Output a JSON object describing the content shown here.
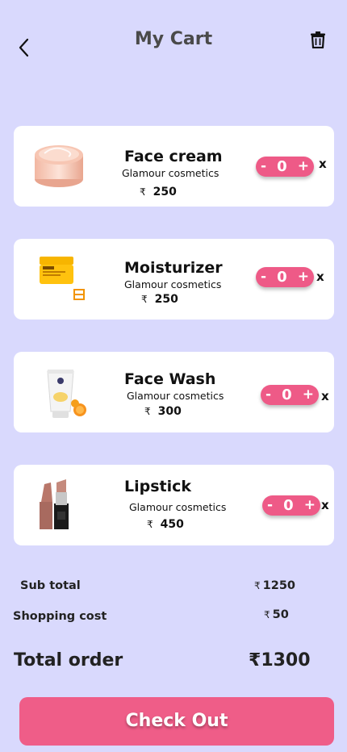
{
  "header": {
    "title": "My Cart",
    "back_icon": "chevron-left-icon",
    "trash_icon": "trash-icon"
  },
  "products": [
    {
      "name": "Face cream",
      "brand": "Glamour cosmetics",
      "currency": "₹",
      "price": "250",
      "qty": "0",
      "minus": "-",
      "plus": "+",
      "remove": "x",
      "icon": "face-cream-jar-icon"
    },
    {
      "name": "Moisturizer",
      "brand": "Glamour cosmetics",
      "currency": "₹",
      "price": "250",
      "qty": "0",
      "minus": "-",
      "plus": "+",
      "remove": "x",
      "icon": "moisturizer-jar-icon"
    },
    {
      "name": "Face Wash",
      "brand": "Glamour cosmetics",
      "currency": "₹",
      "price": "300",
      "qty": "0",
      "minus": "-",
      "plus": "+",
      "remove": "x",
      "icon": "face-wash-tube-icon"
    },
    {
      "name": "Lipstick",
      "brand": "Glamour cosmetics",
      "currency": "₹",
      "price": "450",
      "qty": "0",
      "minus": "-",
      "plus": "+",
      "remove": "x",
      "icon": "lipstick-icon"
    }
  ],
  "summary": {
    "subtotal_label": "Sub total",
    "subtotal_currency": "₹",
    "subtotal_value": "1250",
    "shipping_label": "Shopping cost",
    "shipping_currency": "₹",
    "shipping_value": "50",
    "total_label": "Total order",
    "total_currency": "₹",
    "total_value": "1300"
  },
  "checkout_label": "Check Out",
  "colors": {
    "background": "#d9d9fd",
    "accent": "#ef5d88",
    "card": "#ffffff"
  }
}
